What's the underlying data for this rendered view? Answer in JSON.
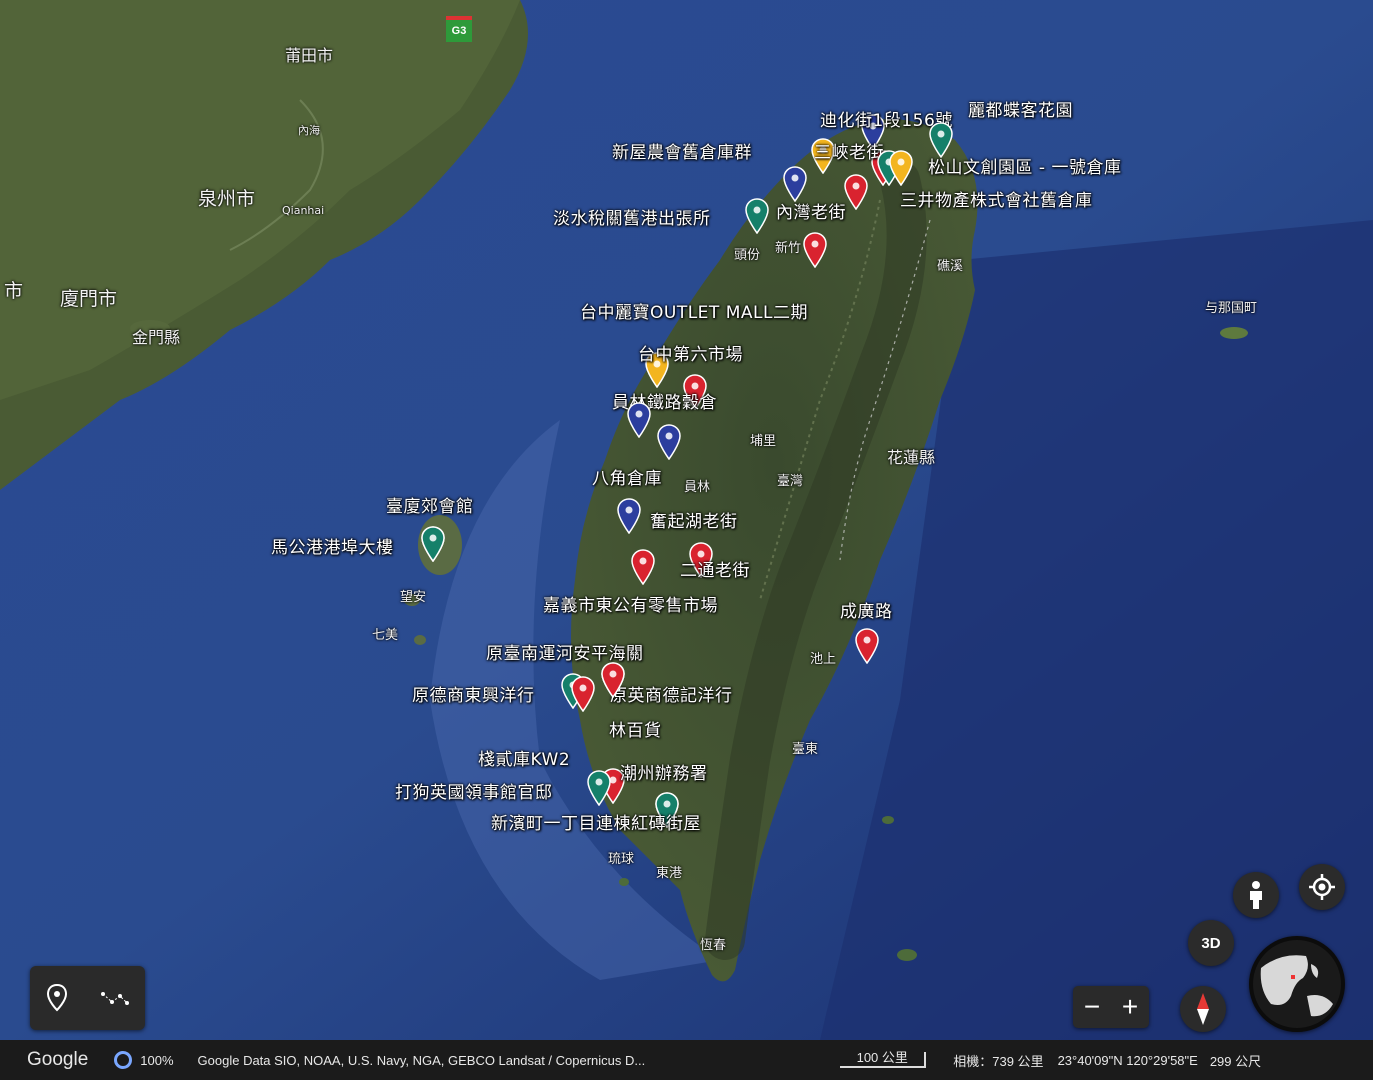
{
  "road_shield": "G3",
  "places": [
    {
      "name": "莆田市",
      "size": "normal"
    },
    {
      "name": "內海",
      "size": "small"
    },
    {
      "name": "泉州市",
      "size": "big"
    },
    {
      "name": "Qianhai",
      "size": "small"
    },
    {
      "name": "市",
      "size": "big"
    },
    {
      "name": "廈門市",
      "size": "big"
    },
    {
      "name": "金門縣",
      "size": "normal"
    },
    {
      "name": "頭份",
      "size": "small"
    },
    {
      "name": "新竹",
      "size": "small"
    },
    {
      "name": "礁溪",
      "size": "small"
    },
    {
      "name": "与那国町",
      "size": "small"
    },
    {
      "name": "埔里",
      "size": "small"
    },
    {
      "name": "花蓮縣",
      "size": "normal"
    },
    {
      "name": "員林",
      "size": "small"
    },
    {
      "name": "臺灣",
      "size": "small"
    },
    {
      "name": "望安",
      "size": "small"
    },
    {
      "name": "七美",
      "size": "small"
    },
    {
      "name": "池上",
      "size": "small"
    },
    {
      "name": "臺東",
      "size": "small"
    },
    {
      "name": "琉球",
      "size": "small"
    },
    {
      "name": "東港",
      "size": "small"
    },
    {
      "name": "恆春",
      "size": "small"
    }
  ],
  "markers": [
    {
      "label": "迪化街1段156號",
      "color": "#2c3e9e"
    },
    {
      "label": "麗都蝶客花園",
      "color": "#15806a"
    },
    {
      "label": "新屋農會舊倉庫群",
      "color": "#f3b51f"
    },
    {
      "label": "三峽老街",
      "color": "#d9232f"
    },
    {
      "label": "松山文創園區 - 一號倉庫",
      "color": "#15806a"
    },
    {
      "label": "三井物產株式會社舊倉庫",
      "color": "#f3b51f"
    },
    {
      "label": "淡水稅關舊港出張所",
      "color": "#15806a"
    },
    {
      "label": "內灣老街",
      "color": "#2c3e9e"
    },
    {
      "label": "",
      "color": "#d9232f"
    },
    {
      "label": "台中麗寶OUTLET MALL二期",
      "color": "#d9232f"
    },
    {
      "label": "台中第六市場",
      "color": "#f3b51f"
    },
    {
      "label": "員林鐵路穀倉",
      "color": "#d9232f"
    },
    {
      "label": "",
      "color": "#2c3e9e"
    },
    {
      "label": "八角倉庫",
      "color": "#2c3e9e"
    },
    {
      "label": "奮起湖老街",
      "color": "#2c3e9e"
    },
    {
      "label": "臺廈郊會館",
      "color": "#15806a"
    },
    {
      "label": "馬公港港埠大樓",
      "color": "#15806a"
    },
    {
      "label": "二通老街",
      "color": "#d9232f"
    },
    {
      "label": "嘉義市東公有零售市場",
      "color": "#d9232f"
    },
    {
      "label": "成廣路",
      "color": "#d9232f"
    },
    {
      "label": "原臺南運河安平海關",
      "color": "#d9232f"
    },
    {
      "label": "原德商東興洋行",
      "color": "#15806a"
    },
    {
      "label": "原英商德記洋行",
      "color": "#d9232f"
    },
    {
      "label": "林百貨",
      "color": "#d9232f"
    },
    {
      "label": "棧貳庫KW2",
      "color": "#d9232f"
    },
    {
      "label": "潮州辦務署",
      "color": "#15806a"
    },
    {
      "label": "打狗英國領事館官邸",
      "color": "#15806a"
    },
    {
      "label": "新濱町一丁目連棟紅磚街屋",
      "color": "#15806a"
    }
  ],
  "controls": {
    "threed_label": "3D",
    "zoom_out": "−",
    "zoom_in": "+"
  },
  "status": {
    "logo": "Google",
    "loaded": "100%",
    "attribution": "Google  Data SIO, NOAA, U.S. Navy, NGA, GEBCO  Landsat / Copernicus  D...",
    "scale": "100 公里",
    "camera": "相機：739 公里",
    "coords": "23°40'09\"N 120°29'58\"E",
    "elevation": "299 公尺"
  }
}
